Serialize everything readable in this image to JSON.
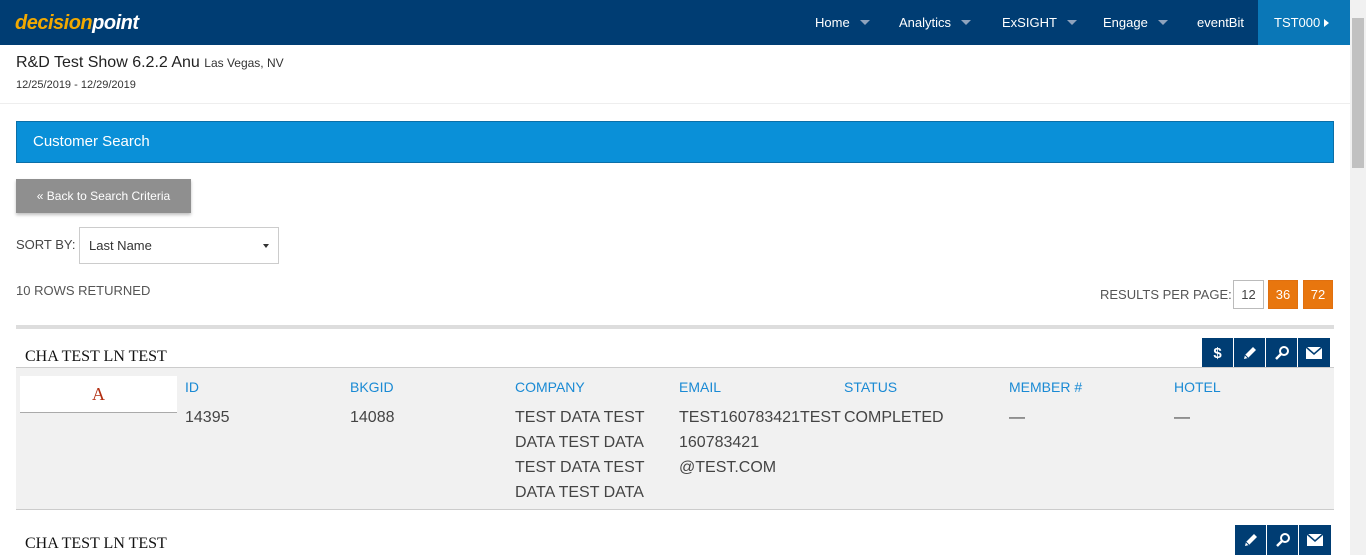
{
  "nav": {
    "logo_part1": "decision",
    "logo_part2": "point",
    "items": [
      {
        "label": "Home"
      },
      {
        "label": "Analytics"
      },
      {
        "label": "ExSIGHT"
      },
      {
        "label": "Engage"
      },
      {
        "label": "eventBit"
      }
    ],
    "user_label": "TST000",
    "colors": {
      "bar": "#003d73",
      "user": "#0a77b7",
      "logo_accent": "#f2a900"
    }
  },
  "show": {
    "title": "R&D Test Show 6.2.2 Anu",
    "location": "Las Vegas, NV",
    "dates": "12/25/2019 - 12/29/2019"
  },
  "panel": {
    "title": "Customer Search",
    "color": "#0a90d8"
  },
  "controls": {
    "back_label": "« Back to Search Criteria",
    "sort_label": "SORT BY:",
    "sort_value": "Last Name",
    "rows_returned": "10 ROWS RETURNED",
    "results_per_page_label": "RESULTS PER PAGE:",
    "page_sizes": [
      "12",
      "36",
      "72"
    ],
    "accent_color": "#e8760e"
  },
  "columns": [
    "ID",
    "BKGID",
    "COMPANY",
    "EMAIL",
    "STATUS",
    "MEMBER #",
    "HOTEL"
  ],
  "records": [
    {
      "name": "CHA TEST LN TEST",
      "avatar_letter": "A",
      "actions": [
        "dollar-icon",
        "pencil-icon",
        "search-icon",
        "envelope-icon"
      ],
      "id": "14395",
      "bkgid": "14088",
      "company_lines": [
        "TEST DATA TEST",
        "DATA TEST DATA",
        "TEST DATA TEST",
        "DATA TEST DATA"
      ],
      "email_lines": [
        "TEST160783421TEST",
        "160783421",
        "@TEST.COM"
      ],
      "status": "COMPLETED",
      "member": "—",
      "hotel": "—"
    },
    {
      "name": "CHA TEST LN TEST",
      "actions": [
        "pencil-icon",
        "search-icon",
        "envelope-icon"
      ]
    }
  ]
}
